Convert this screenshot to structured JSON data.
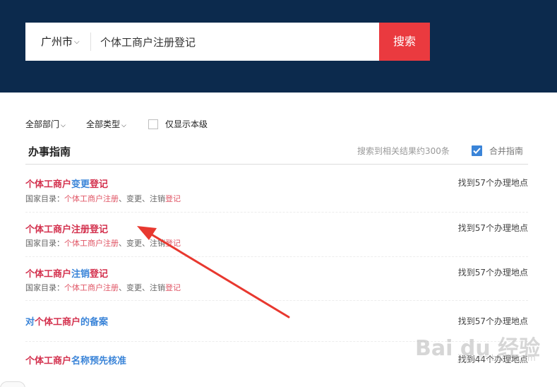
{
  "header": {
    "city": "广州市",
    "search_query": "个体工商户注册登记",
    "search_button": "搜索"
  },
  "filters": {
    "department": "全部部门",
    "type": "全部类型",
    "only_this_level": "仅显示本级"
  },
  "section": {
    "title": "办事指南",
    "result_count": "搜索到相关结果约300条",
    "merge_label": "合并指南"
  },
  "results": [
    {
      "title_red_1": "个体工商户",
      "title_blue": "变更",
      "title_red_2": "登记",
      "catalog_label": "国家目录：",
      "catalog_part1": "个体工商户注册",
      "catalog_part2": "、变更、注销",
      "catalog_part3": "登记",
      "location": "找到57个办理地点"
    },
    {
      "title_red_1": "个体工商户注册登记",
      "title_blue": "",
      "title_red_2": "",
      "catalog_label": "国家目录：",
      "catalog_part1": "个体工商户注册",
      "catalog_part2": "、变更、注销",
      "catalog_part3": "登记",
      "location": "找到57个办理地点"
    },
    {
      "title_red_1": "个体工商户",
      "title_blue": "注销",
      "title_red_2": "登记",
      "catalog_label": "国家目录：",
      "catalog_part1": "个体工商户注册",
      "catalog_part2": "、变更、注销",
      "catalog_part3": "登记",
      "location": "找到57个办理地点"
    },
    {
      "title_blue_pre": "对",
      "title_red_1": "个体工商户",
      "title_blue": "的备案",
      "location": "找到57个办理地点"
    },
    {
      "title_red_1": "个体工商户",
      "title_blue": "名称预先核准",
      "location": "找到44个办理地点"
    }
  ],
  "watermark": {
    "text": "Bai du 经验",
    "sub": "jingyan.baidu.com"
  },
  "colors": {
    "header_bg": "#0c2a4d",
    "search_button": "#ea3a3f",
    "highlight_red": "#d3304d",
    "link_blue": "#3a84d8",
    "annotation_arrow": "#e8382f"
  }
}
